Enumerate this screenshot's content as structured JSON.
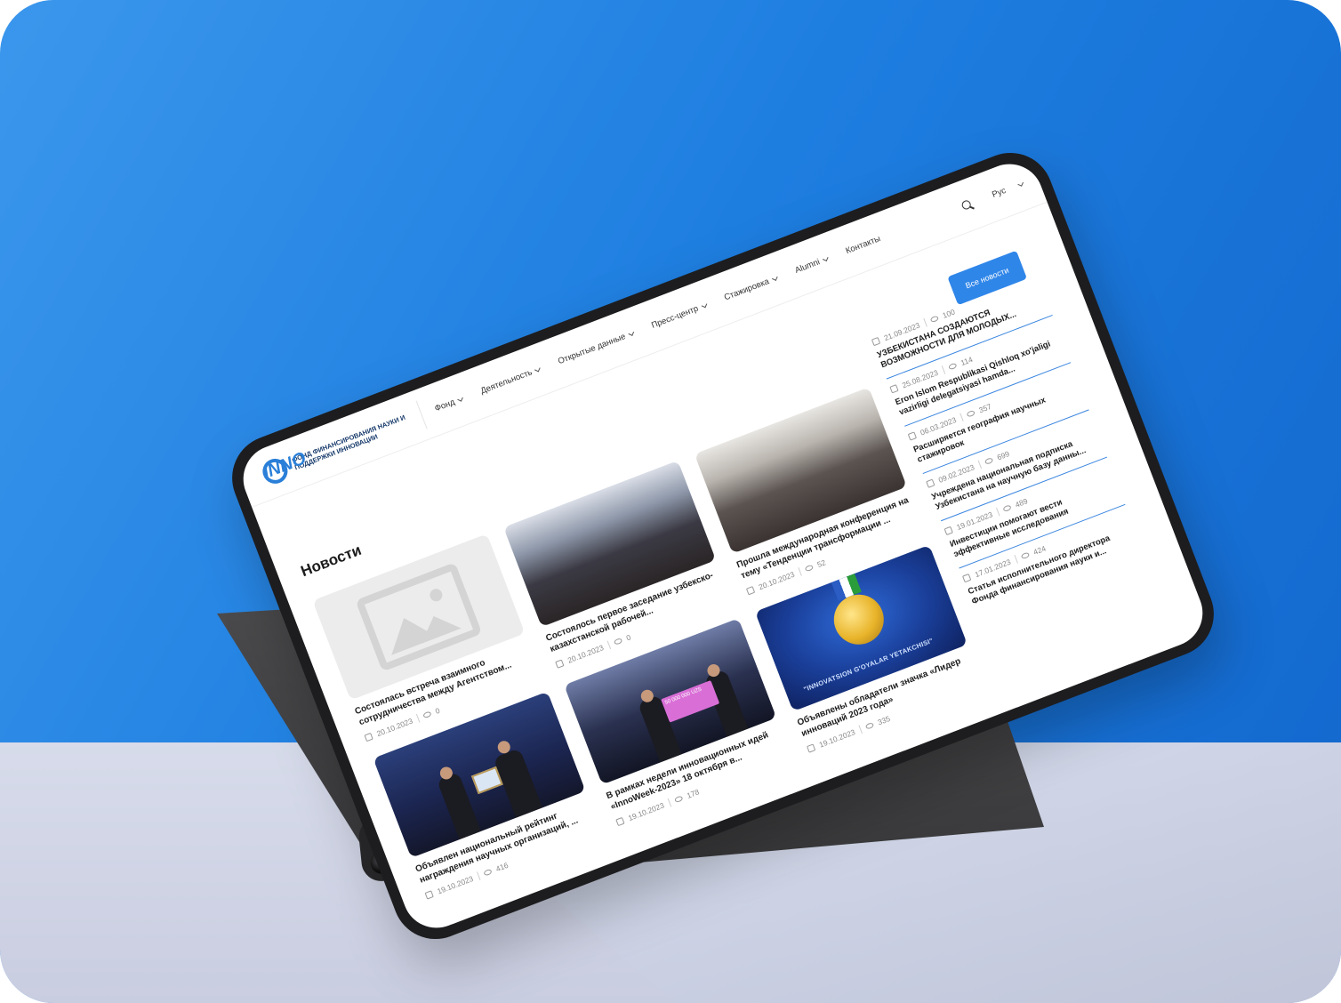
{
  "header": {
    "logo_letters": "INNO",
    "logo_text": "Фонд финансирования науки и поддержки инновации",
    "nav": [
      {
        "label": "Фонд"
      },
      {
        "label": "Деятельность"
      },
      {
        "label": "Открытые данные"
      },
      {
        "label": "Пресс-центр"
      },
      {
        "label": "Стажировка"
      },
      {
        "label": "Alumni"
      },
      {
        "label": "Контакты"
      }
    ],
    "lang": "Рус"
  },
  "page": {
    "title": "Новости",
    "all_news_button": "Все новости"
  },
  "cards": [
    {
      "title": "Состоялась встреча взаимного сотрудничества между Агентством...",
      "date": "20.10.2023",
      "views": "0",
      "image": "placeholder"
    },
    {
      "title": "Состоялось первое заседание узбекско-казахстанской рабочей...",
      "date": "20.10.2023",
      "views": "0",
      "image": "conference-hall"
    },
    {
      "title": "Прошла международная конференция на тему «Тенденции трансформации ...",
      "date": "20.10.2023",
      "views": "52",
      "image": "conference-table"
    },
    {
      "title": "Объявлен национальный рейтинг награждения научных организаций, ...",
      "date": "19.10.2023",
      "views": "416",
      "image": "award-ceremony"
    },
    {
      "title": "В рамках недели инновационных идей «InnoWeek-2023» 18 октября в...",
      "date": "19.10.2023",
      "views": "178",
      "image": "stage-cheque"
    },
    {
      "title": "Объявлены обладатели значка «Лидер инноваций 2023 года»",
      "date": "19.10.2023",
      "views": "335",
      "image": "medal"
    }
  ],
  "medal_caption": "\"INNOVATSION G'OYALAR YETAKCHISI\"",
  "cheque_text": "50 000 000 UZS",
  "sidebar_news": [
    {
      "date": "21.09.2023",
      "views": "100",
      "title": "УЗБЕКИСТАНА СОЗДАЮТСЯ ВОЗМОЖНОСТИ ДЛЯ МОЛОДЫХ..."
    },
    {
      "date": "25.08.2023",
      "views": "114",
      "title": "Eron Islom Respublikasi Qishloq xo'jaligi vazirligi delegatsiyasi hamda..."
    },
    {
      "date": "06.03.2023",
      "views": "357",
      "title": "Расширяется география научных стажировок"
    },
    {
      "date": "09.02.2023",
      "views": "699",
      "title": "Учреждена национальная подписка Узбекистана на научную базу данны..."
    },
    {
      "date": "19.01.2023",
      "views": "489",
      "title": "Инвестиции помогают вести эффективные исследования"
    },
    {
      "date": "17.01.2023",
      "views": "424",
      "title": "Статья исполнительного директора Фонда финансирования науки и..."
    }
  ]
}
